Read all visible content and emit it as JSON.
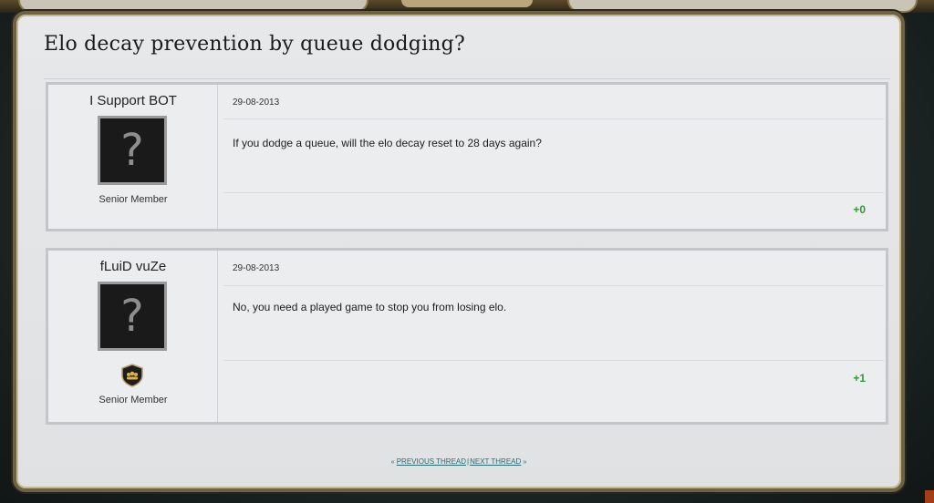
{
  "thread": {
    "title": "Elo decay prevention by queue dodging?"
  },
  "posts": [
    {
      "author": "I Support BOT",
      "avatar_glyph": "?",
      "rank": "Senior Member",
      "date": "29-08-2013",
      "body": "If you dodge a queue, will the elo decay reset to 28 days again?",
      "votes": "+0"
    },
    {
      "author": "fLuiD vuZe",
      "avatar_glyph": "?",
      "badge_icon": "team-badge-icon",
      "rank": "Senior Member",
      "date": "29-08-2013",
      "body": "No, you need a played game to stop you from losing elo.",
      "votes": "+1"
    }
  ],
  "navigation": {
    "prev_marker": "«",
    "prev_label": "PREVIOUS THREAD",
    "separator": "|",
    "next_label": "NEXT THREAD",
    "next_marker": "»"
  },
  "colors": {
    "vote_positive": "#2f9b2f",
    "link": "#2a6c75",
    "panel_border": "#6e6246"
  }
}
